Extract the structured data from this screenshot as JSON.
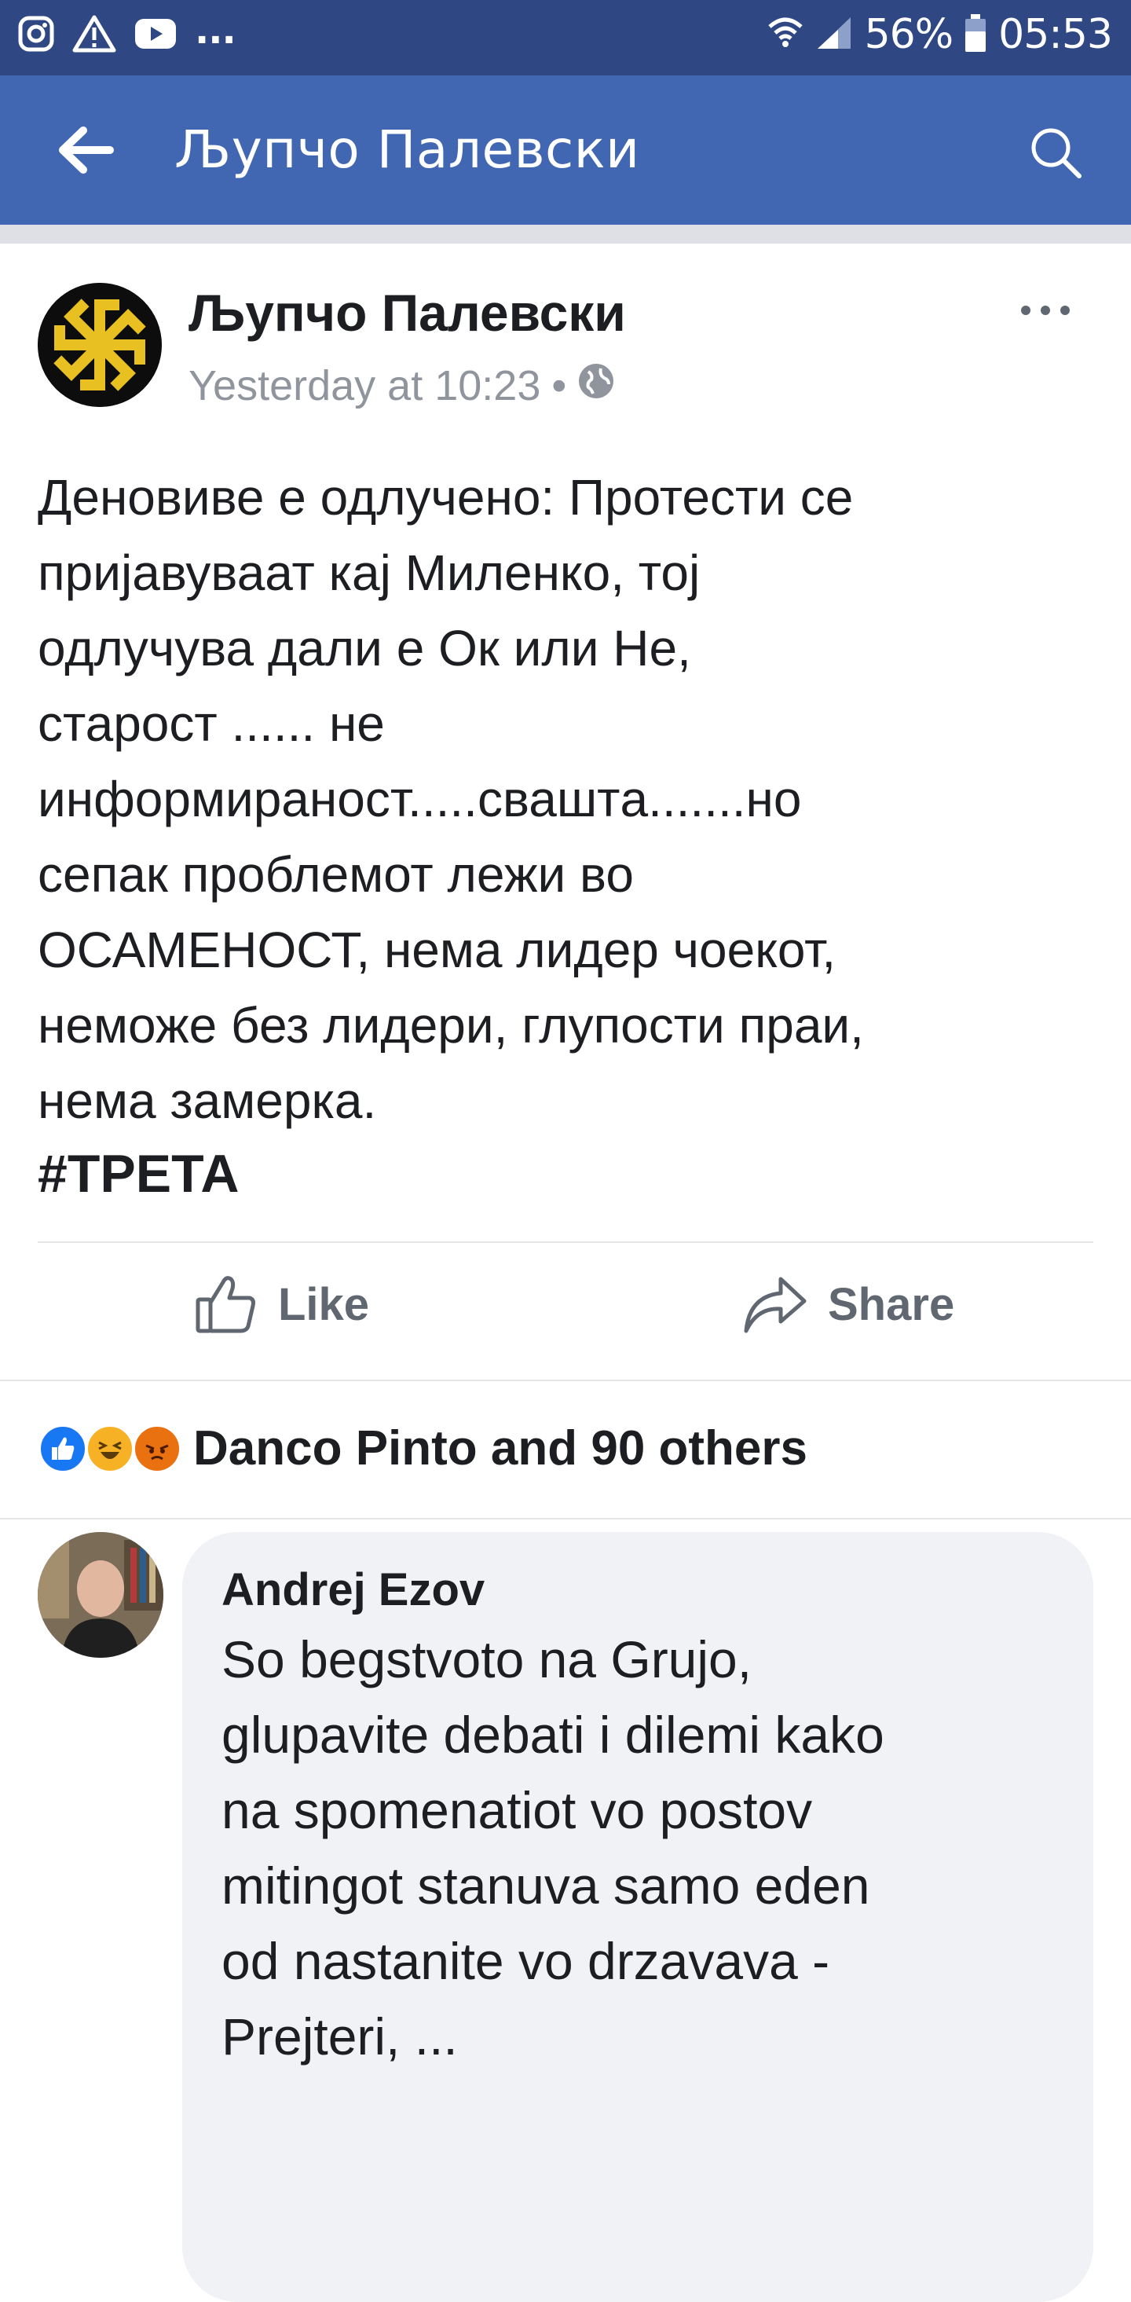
{
  "status_bar": {
    "battery": "56%",
    "time": "05:53",
    "more": "...",
    "icons": [
      "instagram-icon",
      "warning-icon",
      "youtube-icon",
      "wifi-icon",
      "signal-icon",
      "battery-icon"
    ]
  },
  "app_bar": {
    "title": "Љупчо Палевски",
    "background": "#4267b2"
  },
  "post": {
    "author": "Љупчо Палевски",
    "timestamp": "Yesterday at 10:23",
    "separator": "•",
    "privacy_icon": "globe-icon",
    "body": "Деновиве е одлучено: Протести се\nпријавуваат кај Миленко, тој\nодлучува дали е Ок или Не,\nстарост ...... не\nинформираност.....сваштa.......но\nсепак проблемот лежи во\nОСАМЕНОСТ, нема лидер чоекот,\nнеможе без лидери, глупости праи,\nнема замерка.",
    "hashtag": "#ТРЕТА",
    "actions": {
      "like": "Like",
      "share": "Share"
    }
  },
  "reactions": {
    "summary": "Danco Pinto and 90 others",
    "types": [
      "like",
      "haha",
      "angry"
    ]
  },
  "comment": {
    "author": "Andrej Ezov",
    "text": "So begstvoto na Grujo,\nglupavite debati i dilemi kako\nna spomenatiot vo postov\nmitingot stanuva samo eden\nod nastanite vo drzavava -\nPrejteri, ..."
  }
}
